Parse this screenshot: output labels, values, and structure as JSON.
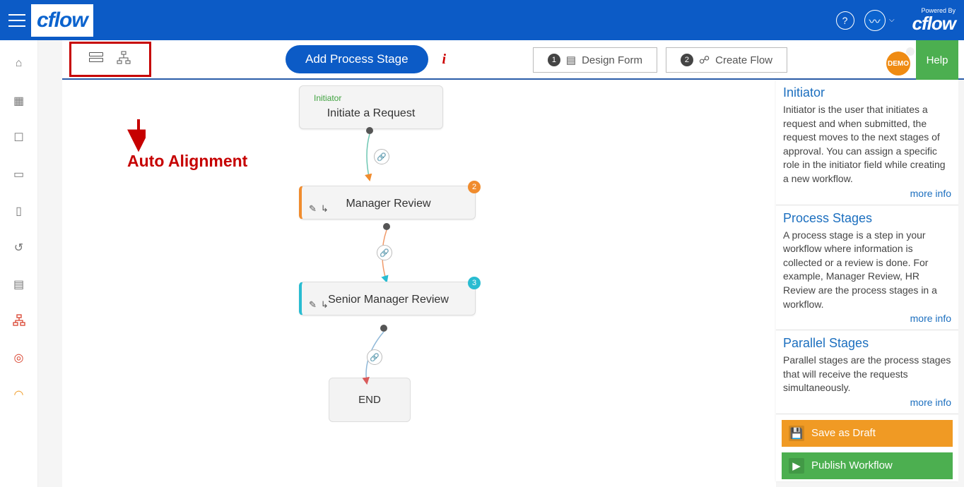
{
  "topbar": {
    "powered_by": "Powered By",
    "brand": "cflow"
  },
  "toolbar": {
    "add_stage": "Add Process Stage",
    "tab1": "Design Form",
    "tab2": "Create Flow",
    "help": "Help",
    "demo": "DEMO"
  },
  "annotation": {
    "text": "Auto Alignment"
  },
  "flow": {
    "node1_label": "Initiator",
    "node1_title": "Initiate a Request",
    "node2_title": "Manager Review",
    "node2_badge": "2",
    "node3_title": "Senior Manager Review",
    "node3_badge": "3",
    "end": "END"
  },
  "help": {
    "s1_title": "Initiator",
    "s1_body": "Initiator is the user that initiates a request and when submitted, the request moves to the next stages of approval. You can assign a specific role in the initiator field while creating a new workflow.",
    "s2_title": "Process Stages",
    "s2_body": "A process stage is a step in your workflow where information is collected or a review is done. For example, Manager Review, HR Review are the process stages in a workflow.",
    "s3_title": "Parallel Stages",
    "s3_body": "Parallel stages are the process stages that will receive the requests simultaneously.",
    "more": "more info",
    "save": "Save as Draft",
    "publish": "Publish Workflow"
  }
}
